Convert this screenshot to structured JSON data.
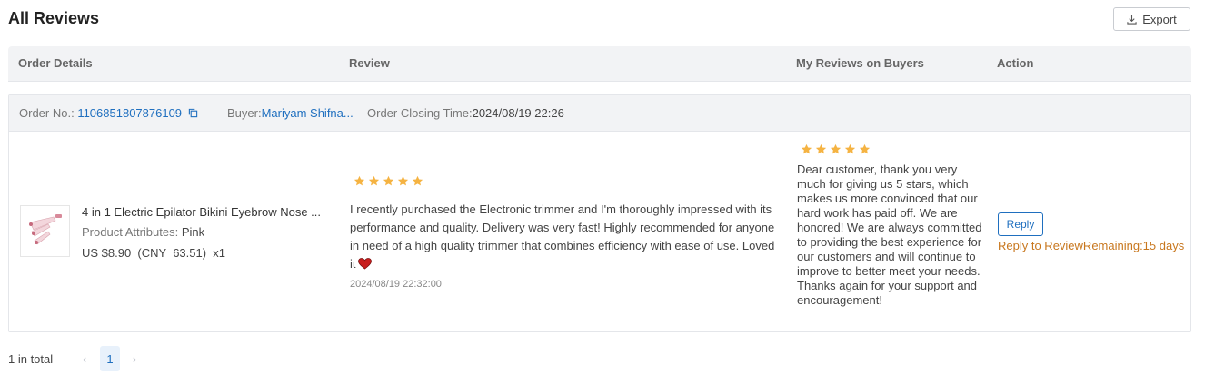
{
  "page": {
    "title": "All Reviews",
    "export_label": "Export"
  },
  "table_header": {
    "order_details": "Order Details",
    "review": "Review",
    "my_reviews_on_buyers": "My Reviews on Buyers",
    "action": "Action"
  },
  "order": {
    "order_no_label": "Order No.:",
    "order_no": "1106851807876109",
    "buyer_label": "Buyer:",
    "buyer_name": "Mariyam Shifna...",
    "closing_time_label": "Order Closing Time:",
    "closing_time": "2024/08/19 22:26"
  },
  "product": {
    "title": "4 in 1 Electric Epilator Bikini Eyebrow Nose ...",
    "attributes_label": "Product Attributes:",
    "attributes_value": "Pink",
    "price": "US $8.90  (CNY  63.51)  x1"
  },
  "review": {
    "rating": 5,
    "text": "I recently purchased the Electronic trimmer and I'm thoroughly impressed with its performance and quality. Delivery was very fast! Highly recommended for anyone in need of a high quality trimmer that combines efficiency with ease of use. Loved it",
    "time": "2024/08/19 22:32:00"
  },
  "my_review": {
    "rating": 5,
    "text": "Dear customer, thank you very much for giving us 5 stars, which makes us more convinced that our hard work has paid off. We are honored! We are always committed to providing the best experience for our customers and will continue to improve to better meet your needs. Thanks again for your support and encouragement!"
  },
  "action": {
    "reply_label": "Reply",
    "remaining_text": "Reply to ReviewRemaining:15 days"
  },
  "pagination": {
    "total_text": "1 in total",
    "current_page": "1",
    "prev_glyph": "‹",
    "next_glyph": "›"
  },
  "colors": {
    "accent": "#1f6fbf",
    "star": "#f5b342",
    "warning": "#c8771e",
    "heart": "#c81e1e"
  },
  "icons": [
    "download-icon",
    "copy-icon",
    "star-icon",
    "heart-icon",
    "chevron-left-icon",
    "chevron-right-icon"
  ]
}
